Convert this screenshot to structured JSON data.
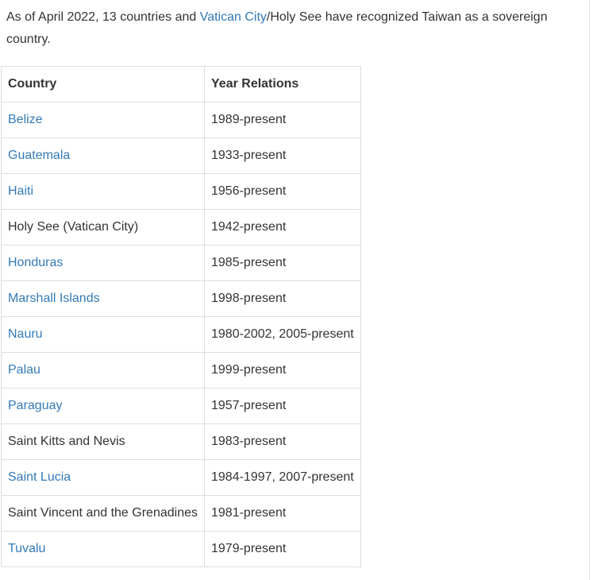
{
  "intro": {
    "before_link": "As of April 2022, 13 countries and ",
    "link_text": "Vatican City",
    "after_link": "/Holy See have recognized Taiwan as a sovereign country."
  },
  "table": {
    "headers": {
      "country": "Country",
      "year": "Year Relations"
    },
    "rows": [
      {
        "country": "Belize",
        "year": "1989-present",
        "is_link": true
      },
      {
        "country": "Guatemala",
        "year": "1933-present",
        "is_link": true
      },
      {
        "country": "Haiti",
        "year": "1956-present",
        "is_link": true
      },
      {
        "country": "Holy See (Vatican City)",
        "year": "1942-present",
        "is_link": false
      },
      {
        "country": "Honduras",
        "year": "1985-present",
        "is_link": true
      },
      {
        "country": "Marshall Islands",
        "year": "1998-present",
        "is_link": true
      },
      {
        "country": "Nauru",
        "year": "1980-2002, 2005-present",
        "is_link": true
      },
      {
        "country": "Palau",
        "year": "1999-present",
        "is_link": true
      },
      {
        "country": "Paraguay",
        "year": "1957-present",
        "is_link": true
      },
      {
        "country": "Saint Kitts and Nevis",
        "year": "1983-present",
        "is_link": false
      },
      {
        "country": "Saint Lucia",
        "year": "1984-1997, 2007-present",
        "is_link": true
      },
      {
        "country": "Saint Vincent and the Grenadines",
        "year": "1981-present",
        "is_link": false
      },
      {
        "country": "Tuvalu",
        "year": "1979-present",
        "is_link": true
      }
    ]
  },
  "colors": {
    "link": "#337ab7",
    "text": "#333333",
    "border": "#dddddd"
  }
}
